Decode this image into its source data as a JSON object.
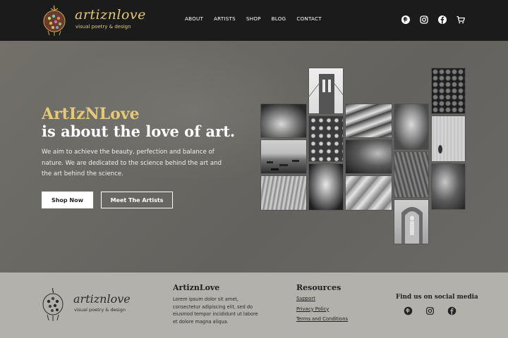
{
  "header": {
    "brand_name": "artiznlove",
    "brand_tagline": "visual poetry & design",
    "nav": [
      "ABOUT",
      "ARTISTS",
      "SHOP",
      "BLOG",
      "CONTACT"
    ],
    "icons": [
      "pinterest-icon",
      "instagram-icon",
      "facebook-icon",
      "cart-icon"
    ]
  },
  "hero": {
    "title_line1": "ArtIzNLove",
    "title_line2": "is about the love of art.",
    "copy": "We aim to achieve the beauty, perfection and balance of nature. We are dedicated to the science behind the art and the art behind the science.",
    "primary_button": "Shop Now",
    "secondary_button": "Meet The Artists"
  },
  "footer": {
    "brand_name": "artiznlove",
    "brand_tagline": "visual poetry & design",
    "about_title": "ArtiznLove",
    "about_text": "Lorem ipsum dolor sit amet, consectetur adipiscing elit, sed do eiusmod tempor incididunt ut labore et dolore magna aliqua.",
    "resources_title": "Resources",
    "resources_links": [
      "Support",
      "Privacy Policy",
      "Terms and Conditions"
    ],
    "social_title": "Find us on social media",
    "social_icons": [
      "pinterest-icon",
      "instagram-icon",
      "facebook-icon"
    ]
  },
  "colors": {
    "header_bg": "#1b1b1b",
    "accent_gold": "#e6c877",
    "hero_bg": "#6b6964",
    "footer_bg": "#b2b1ac"
  }
}
